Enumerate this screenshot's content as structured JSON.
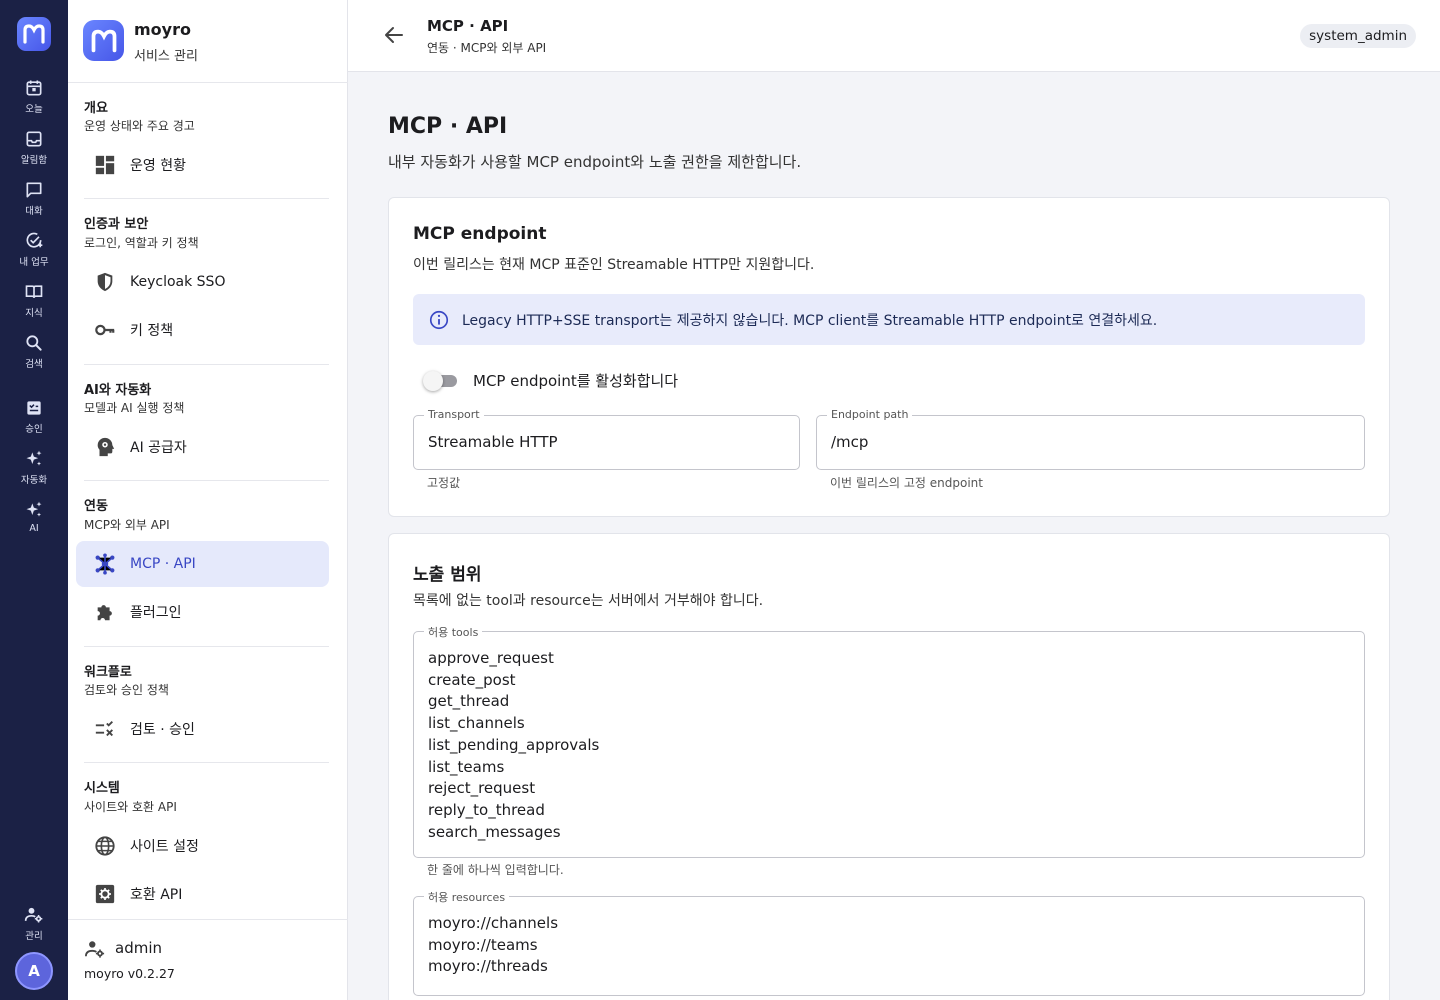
{
  "rail": {
    "items": [
      {
        "label": "오늘",
        "icon": "calendar-icon"
      },
      {
        "label": "알림함",
        "icon": "inbox-icon"
      },
      {
        "label": "대화",
        "icon": "chat-icon"
      },
      {
        "label": "내 업무",
        "icon": "task-check-icon"
      },
      {
        "label": "지식",
        "icon": "book-icon"
      },
      {
        "label": "검색",
        "icon": "search-icon"
      },
      {
        "label": "승인",
        "icon": "approval-icon"
      },
      {
        "label": "자동화",
        "icon": "sparkle-icon"
      },
      {
        "label": "AI",
        "icon": "ai-sparkle-icon"
      }
    ],
    "admin_label": "관리",
    "avatar": "A"
  },
  "sidebar": {
    "brand": "moyro",
    "brand_sub": "서비스 관리",
    "sections": [
      {
        "title": "개요",
        "sub": "운영 상태와 주요 경고",
        "items": [
          {
            "label": "운영 현황",
            "icon": "dashboard-icon"
          }
        ]
      },
      {
        "title": "인증과 보안",
        "sub": "로그인, 역할과 키 정책",
        "items": [
          {
            "label": "Keycloak SSO",
            "icon": "shield-icon"
          },
          {
            "label": "키 정책",
            "icon": "key-icon"
          }
        ]
      },
      {
        "title": "AI와 자동화",
        "sub": "모델과 AI 실행 정책",
        "items": [
          {
            "label": "AI 공급자",
            "icon": "ai-head-icon"
          }
        ]
      },
      {
        "title": "연동",
        "sub": "MCP와 외부 API",
        "items": [
          {
            "label": "MCP · API",
            "icon": "hub-icon"
          },
          {
            "label": "플러그인",
            "icon": "puzzle-icon"
          }
        ]
      },
      {
        "title": "워크플로",
        "sub": "검토와 승인 정책",
        "items": [
          {
            "label": "검토 · 승인",
            "icon": "rule-icon"
          }
        ]
      },
      {
        "title": "시스템",
        "sub": "사이트와 호환 API",
        "items": [
          {
            "label": "사이트 설정",
            "icon": "globe-icon"
          },
          {
            "label": "호환 API",
            "icon": "settings-box-icon"
          }
        ]
      }
    ],
    "active_item": "MCP · API",
    "footer": {
      "user": "admin",
      "version": "moyro v0.2.27"
    }
  },
  "topbar": {
    "title": "MCP · API",
    "subtitle": "연동 · MCP와 외부 API",
    "role": "system_admin"
  },
  "main": {
    "title": "MCP · API",
    "description": "내부 자동화가 사용할 MCP endpoint와 노출 권한을 제한합니다.",
    "endpoint_card": {
      "title": "MCP endpoint",
      "description": "이번 릴리스는 현재 MCP 표준인 Streamable HTTP만 지원합니다.",
      "alert": "Legacy HTTP+SSE transport는 제공하지 않습니다. MCP client를 Streamable HTTP endpoint로 연결하세요.",
      "toggle_label": "MCP endpoint를 활성화합니다",
      "toggle_on": false,
      "transport": {
        "label": "Transport",
        "value": "Streamable HTTP",
        "helper": "고정값"
      },
      "path": {
        "label": "Endpoint path",
        "value": "/mcp",
        "helper": "이번 릴리스의 고정 endpoint"
      }
    },
    "scope_card": {
      "title": "노출 범위",
      "description": "목록에 없는 tool과 resource는 서버에서 거부해야 합니다.",
      "tools": {
        "label": "허용 tools",
        "value": "approve_request\ncreate_post\nget_thread\nlist_channels\nlist_pending_approvals\nlist_teams\nreject_request\nreply_to_thread\nsearch_messages",
        "helper": "한 줄에 하나씩 입력합니다."
      },
      "resources": {
        "label": "허용 resources",
        "value": "moyro://channels\nmoyro://teams\nmoyro://threads"
      }
    }
  },
  "colors": {
    "rail_bg": "#1b2145",
    "accent": "#3947c4",
    "active_bg": "#e5e9fb",
    "alert_bg": "#e8ebfb"
  }
}
